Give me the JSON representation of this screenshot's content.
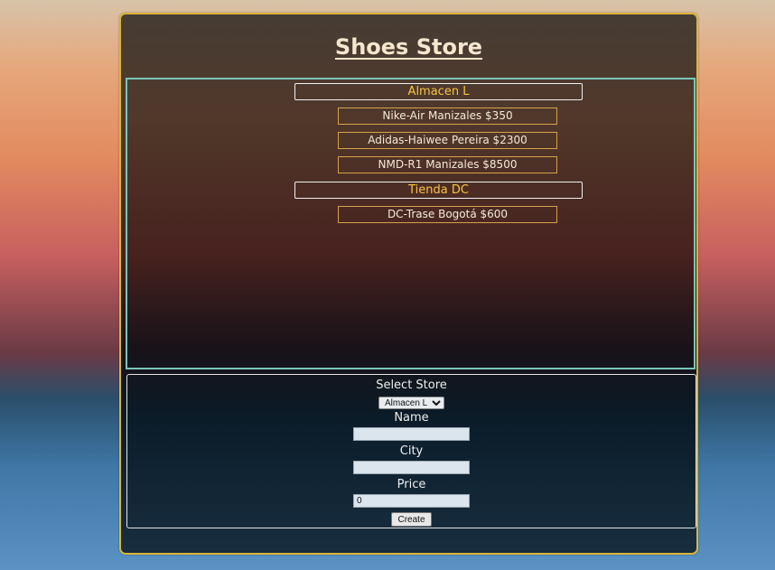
{
  "page": {
    "title": "Shoes Store"
  },
  "stores": [
    {
      "name": "Almacen L",
      "items": [
        "Nike-Air Manizales $350",
        "Adidas-Haiwee Pereira $2300",
        "NMD-R1 Manizales $8500"
      ]
    },
    {
      "name": "Tienda DC",
      "items": [
        "DC-Trase Bogotá $600"
      ]
    }
  ],
  "form": {
    "select_store_label": "Select Store",
    "selected_store": "Almacen L",
    "store_options": [
      "Almacen L"
    ],
    "name_label": "Name",
    "name_value": "",
    "city_label": "City",
    "city_value": "",
    "price_label": "Price",
    "price_value": "0",
    "create_label": "Create"
  },
  "colors": {
    "card_border": "#d9b43a",
    "list_border": "#78c6b8",
    "store_text": "#f6c443",
    "item_border": "#d6a14a"
  }
}
